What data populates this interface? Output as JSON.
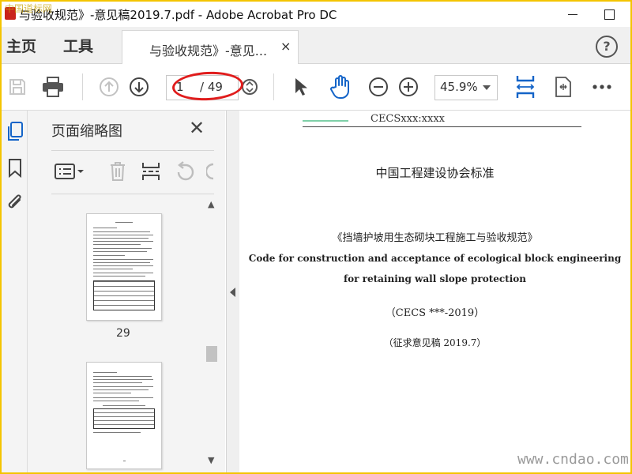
{
  "window": {
    "title": "与验收规范》-意见稿2019.7.pdf - Adobe Acrobat Pro DC",
    "corner_watermark": "中国道标网"
  },
  "menubar": {
    "home": "主页",
    "tools": "工具",
    "doc_tab_label": "与验收规范》-意见...",
    "close_glyph": "×",
    "help_glyph": "?"
  },
  "toolbar": {
    "current_page": "1",
    "page_total": "/ 49",
    "zoom": "45.9%"
  },
  "thumbnail_panel": {
    "title": "页面缩略图",
    "close_glyph": "✕",
    "page_numbers": [
      "29"
    ]
  },
  "document": {
    "code": "CECSxxx:xxxx",
    "organization": "中国工程建设协会标准",
    "title_cn": "《挡墙护坡用生态砌块工程施工与验收规范》",
    "title_en_line1": "Code for construction and acceptance of ecological block engineering",
    "title_en_line2": "for retaining wall slope protection",
    "standard_no": "（CECS ***-2019）",
    "draft_note": "（征求意见稿 2019.7）",
    "watermark": "www.cndao.com"
  },
  "colors": {
    "accent_blue": "#1464c8",
    "annotation_red": "#e01c1c",
    "frame_yellow": "#f4c400"
  }
}
